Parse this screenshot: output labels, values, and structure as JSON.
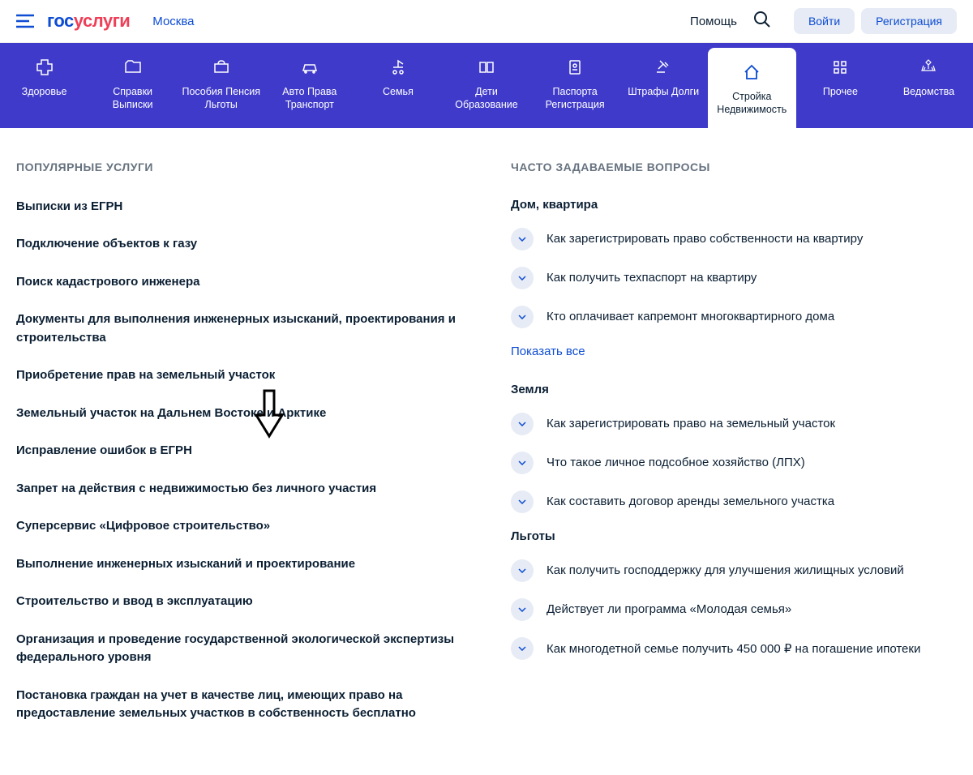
{
  "header": {
    "logo_part1": "гос",
    "logo_part2": "услуги",
    "city": "Москва",
    "help": "Помощь",
    "login": "Войти",
    "register": "Регистрация"
  },
  "nav": [
    {
      "label": "Здоровье"
    },
    {
      "label": "Справки Выписки"
    },
    {
      "label": "Пособия Пенсия Льготы"
    },
    {
      "label": "Авто Права Транспорт"
    },
    {
      "label": "Семья"
    },
    {
      "label": "Дети Образование"
    },
    {
      "label": "Паспорта Регистрация"
    },
    {
      "label": "Штрафы Долги"
    },
    {
      "label": "Стройка Недвижимость"
    },
    {
      "label": "Прочее"
    },
    {
      "label": "Ведомства"
    }
  ],
  "popular": {
    "title": "ПОПУЛЯРНЫЕ УСЛУГИ",
    "items": [
      "Выписки из ЕГРН",
      "Подключение объектов к газу",
      "Поиск кадастрового инженера",
      "Документы для выполнения инженерных изысканий, проектирования и строительства",
      "Приобретение прав на земельный участок",
      "Земельный участок на Дальнем Востоке и Арктике",
      "Исправление ошибок в ЕГРН",
      "Запрет на действия с недвижимостью без личного участия",
      "Суперсервис «Цифровое строительство»",
      "Выполнение инженерных изысканий и проектирование",
      "Строительство и ввод в эксплуатацию",
      "Организация и проведение государственной экологической экспертизы федерального уровня",
      "Постановка граждан на учет в качестве лиц, имеющих право на предоставление земельных участков в собственность бесплатно"
    ]
  },
  "faq": {
    "title": "ЧАСТО ЗАДАВАЕМЫЕ ВОПРОСЫ",
    "show_all": "Показать все",
    "groups": [
      {
        "heading": "Дом, квартира",
        "items": [
          "Как зарегистрировать право собственности на квартиру",
          "Как получить техпаспорт на квартиру",
          "Кто оплачивает капремонт многоквартирного дома"
        ]
      },
      {
        "heading": "Земля",
        "items": [
          "Как зарегистрировать право на земельный участок",
          "Что такое личное подсобное хозяйство (ЛПХ)",
          "Как составить договор аренды земельного участка"
        ]
      },
      {
        "heading": "Льготы",
        "items": [
          "Как получить господдержку для улучшения жилищных условий",
          "Действует ли программа «Молодая семья»",
          "Как многодетной семье получить 450 000 ₽ на погашение ипотеки"
        ]
      }
    ]
  }
}
